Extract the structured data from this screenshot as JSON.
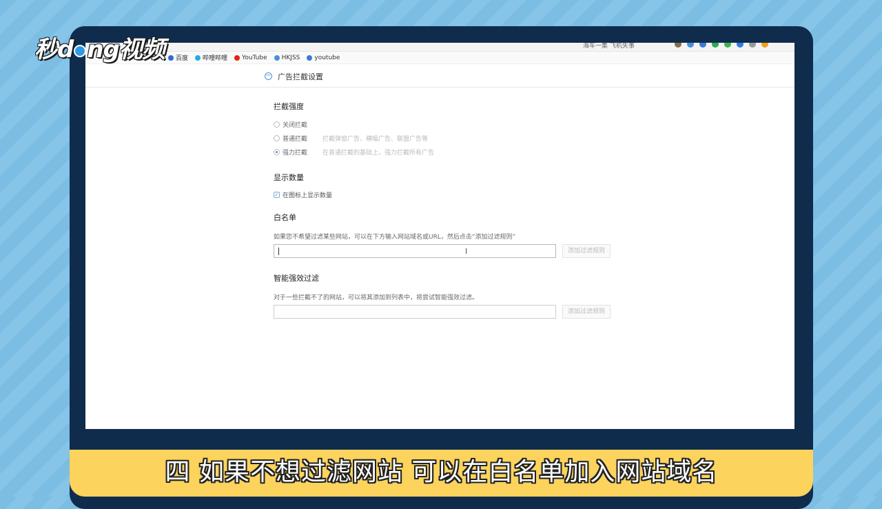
{
  "logo": {
    "text_before": "秒d",
    "text_after": "ng视频"
  },
  "browser": {
    "search_hint": "海车一集 飞机失事",
    "bookmarks": [
      {
        "label": "百度",
        "icon": "baidu-icon",
        "color": "#2e6bd6"
      },
      {
        "label": "哔哩哔哩",
        "icon": "bilibili-icon",
        "color": "#23ade5"
      },
      {
        "label": "YouTube",
        "icon": "youtube-icon",
        "color": "#e62117"
      },
      {
        "label": "HKJSS",
        "icon": "pin-icon",
        "color": "#4a90d9"
      },
      {
        "label": "youtube",
        "icon": "globe-icon",
        "color": "#3a7bd5"
      }
    ]
  },
  "page": {
    "title": "广告拦截设置",
    "strength": {
      "heading": "拦截强度",
      "options": [
        {
          "label": "关闭拦截",
          "desc": "",
          "selected": false
        },
        {
          "label": "普通拦截",
          "desc": "拦截弹窗广告、横幅广告、联盟广告等",
          "selected": false
        },
        {
          "label": "强力拦截",
          "desc": "在普通拦截的基础上，强力拦截所有广告",
          "selected": true
        }
      ]
    },
    "count": {
      "heading": "显示数量",
      "checkbox_label": "在图标上显示数量",
      "checked": true
    },
    "whitelist": {
      "heading": "白名单",
      "help": "如果您不希望过滤某些网站，可以在下方输入网站域名或URL，然后点击“添加过滤规则”",
      "input_value": "",
      "button": "添加过滤规则"
    },
    "smart": {
      "heading": "智能强效过滤",
      "help": "对于一些拦截不了的网站，可以将其添加到列表中，将尝试智能强效过滤。",
      "input_value": "",
      "button": "添加过滤规则"
    }
  },
  "subtitle": "四 如果不想过滤网站 可以在白名单加入网站域名"
}
